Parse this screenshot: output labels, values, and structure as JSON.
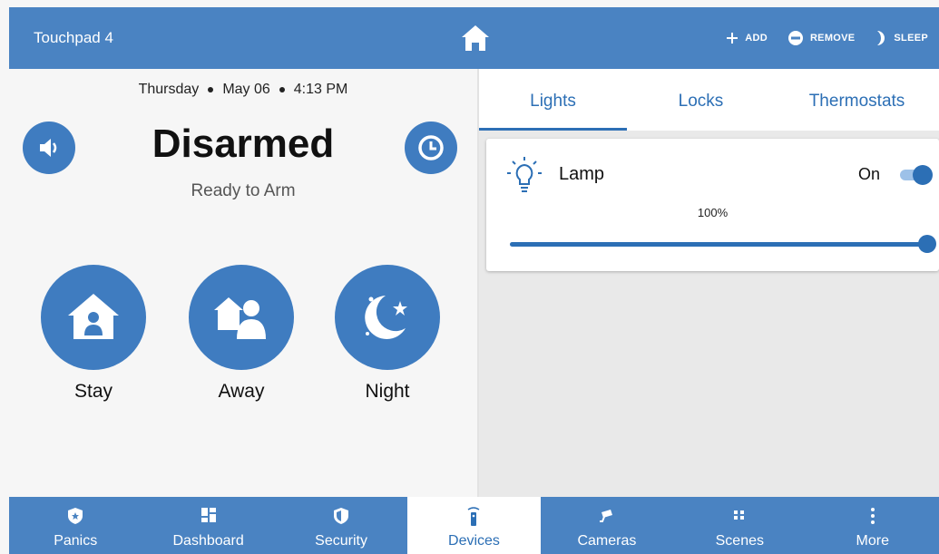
{
  "header": {
    "title": "Touchpad 4",
    "home_icon": "home-icon",
    "actions": [
      {
        "label": "ADD",
        "icon": "plus-icon"
      },
      {
        "label": "REMOVE",
        "icon": "minus-circle-icon"
      },
      {
        "label": "SLEEP",
        "icon": "moon-icon"
      }
    ]
  },
  "security": {
    "day": "Thursday",
    "date": "May 06",
    "time": "4:13 PM",
    "status": "Disarmed",
    "substatus": "Ready to Arm",
    "left_button_icon": "speaker-icon",
    "right_button_icon": "clock-icon",
    "modes": [
      {
        "label": "Stay",
        "icon": "home-person-icon"
      },
      {
        "label": "Away",
        "icon": "person-leaving-icon"
      },
      {
        "label": "Night",
        "icon": "moon-stars-icon"
      }
    ]
  },
  "devices": {
    "tabs": [
      "Lights",
      "Locks",
      "Thermostats"
    ],
    "active_tab": "Lights",
    "lights": [
      {
        "name": "Lamp",
        "state": "On",
        "on": true,
        "level_label": "100%",
        "level": 1.0
      }
    ]
  },
  "bottom_nav": {
    "active": "Devices",
    "items": [
      {
        "label": "Panics",
        "icon": "shield-star-icon"
      },
      {
        "label": "Dashboard",
        "icon": "dashboard-grid-icon"
      },
      {
        "label": "Security",
        "icon": "shield-icon"
      },
      {
        "label": "Devices",
        "icon": "remote-icon"
      },
      {
        "label": "Cameras",
        "icon": "camera-icon"
      },
      {
        "label": "Scenes",
        "icon": "scenes-icon"
      },
      {
        "label": "More",
        "icon": "more-vertical-icon"
      }
    ]
  },
  "colors": {
    "primary": "#4a83c2",
    "accent": "#2c6fb5",
    "panel_bg": "#f6f6f6",
    "content_bg": "#e9e9e9"
  }
}
